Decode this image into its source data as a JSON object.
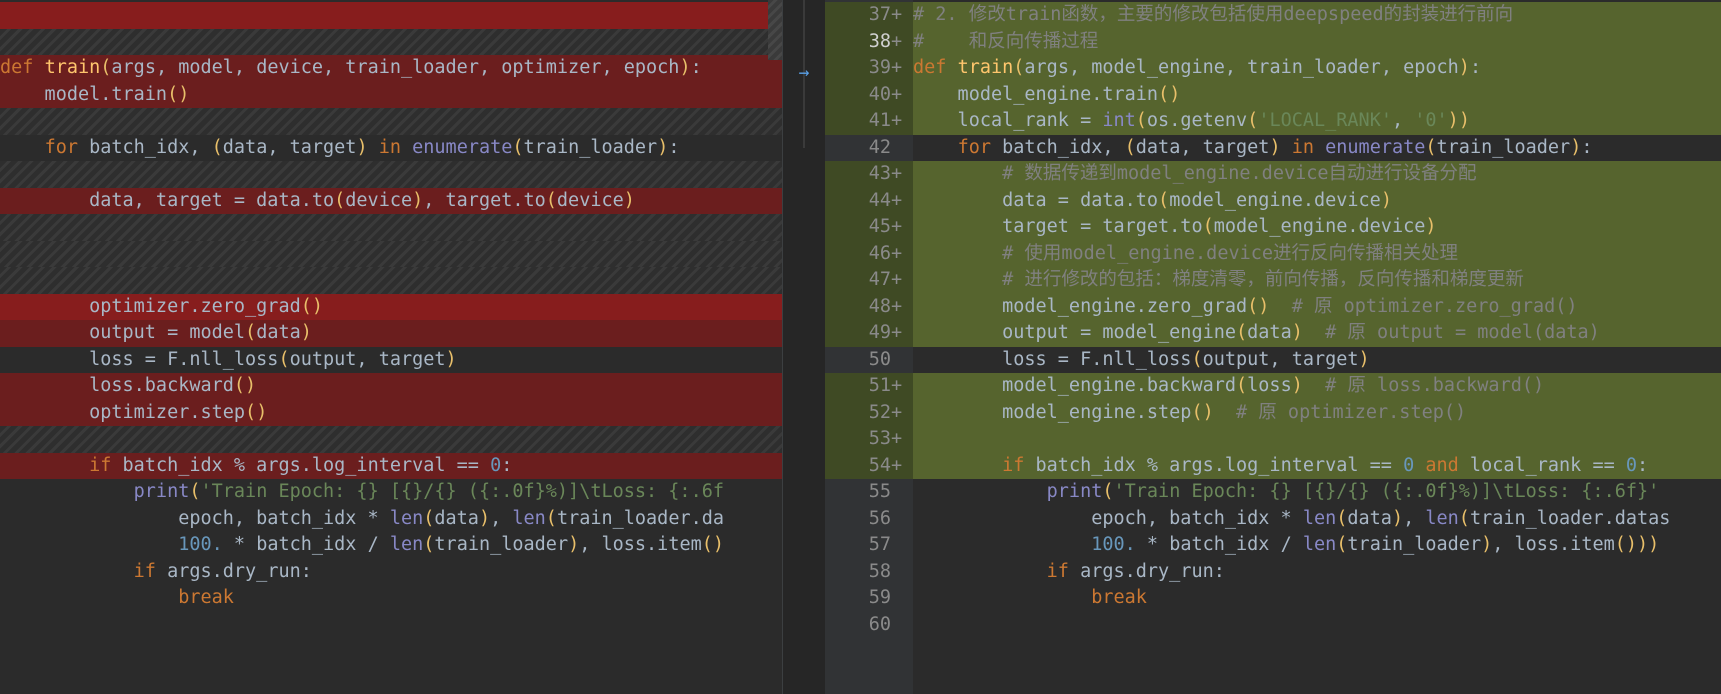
{
  "left": {
    "lines": [
      {
        "kind": "del-strong",
        "text": ""
      },
      {
        "kind": "hatch",
        "text": ""
      },
      {
        "kind": "del",
        "text": "def train(args, model, device, train_loader, optimizer, epoch):"
      },
      {
        "kind": "del",
        "text": "    model.train()"
      },
      {
        "kind": "hatch",
        "text": ""
      },
      {
        "kind": "plain",
        "text": "    for batch_idx, (data, target) in enumerate(train_loader):"
      },
      {
        "kind": "hatch",
        "text": ""
      },
      {
        "kind": "del",
        "text": "        data, target = data.to(device), target.to(device)"
      },
      {
        "kind": "hatch",
        "text": ""
      },
      {
        "kind": "hatch",
        "text": ""
      },
      {
        "kind": "hatch",
        "text": ""
      },
      {
        "kind": "del-strong",
        "text": "        optimizer.zero_grad()"
      },
      {
        "kind": "del",
        "text": "        output = model(data)"
      },
      {
        "kind": "plain",
        "text": "        loss = F.nll_loss(output, target)"
      },
      {
        "kind": "del",
        "text": "        loss.backward()"
      },
      {
        "kind": "del",
        "text": "        optimizer.step()"
      },
      {
        "kind": "hatch",
        "text": ""
      },
      {
        "kind": "del",
        "text": "        if batch_idx % args.log_interval == 0:"
      },
      {
        "kind": "plain",
        "text": "            print('Train Epoch: {} [{}/{} ({:.0f}%)]\\tLoss: {:.6f"
      },
      {
        "kind": "plain",
        "text": "                epoch, batch_idx * len(data), len(train_loader.da"
      },
      {
        "kind": "plain",
        "text": "                100. * batch_idx / len(train_loader), loss.item()"
      },
      {
        "kind": "plain",
        "text": "            if args.dry_run:"
      },
      {
        "kind": "plain",
        "text": "                break"
      },
      {
        "kind": "plain",
        "text": ""
      }
    ]
  },
  "right": {
    "lines": [
      {
        "num": "37",
        "mark": "+",
        "kind": "add",
        "text": "# 2. 修改train函数，主要的修改包括使用deepspeed的封装进行前向"
      },
      {
        "num": "38",
        "mark": "+",
        "kind": "add",
        "text": "#    和反向传播过程"
      },
      {
        "num": "39",
        "mark": "+",
        "kind": "add",
        "text": "def train(args, model_engine, train_loader, epoch):"
      },
      {
        "num": "40",
        "mark": "+",
        "kind": "add",
        "text": "    model_engine.train()"
      },
      {
        "num": "41",
        "mark": "+",
        "kind": "add",
        "text": "    local_rank = int(os.getenv('LOCAL_RANK', '0'))"
      },
      {
        "num": "42",
        "mark": "",
        "kind": "plain",
        "text": "    for batch_idx, (data, target) in enumerate(train_loader):"
      },
      {
        "num": "43",
        "mark": "+",
        "kind": "add",
        "text": "        # 数据传递到model_engine.device自动进行设备分配"
      },
      {
        "num": "44",
        "mark": "+",
        "kind": "add",
        "text": "        data = data.to(model_engine.device)"
      },
      {
        "num": "45",
        "mark": "+",
        "kind": "add",
        "text": "        target = target.to(model_engine.device)"
      },
      {
        "num": "46",
        "mark": "+",
        "kind": "add",
        "text": "        # 使用model_engine.device进行反向传播相关处理"
      },
      {
        "num": "47",
        "mark": "+",
        "kind": "add",
        "text": "        # 进行修改的包括：梯度清零，前向传播，反向传播和梯度更新"
      },
      {
        "num": "48",
        "mark": "+",
        "kind": "add",
        "text": "        model_engine.zero_grad()  # 原 optimizer.zero_grad()"
      },
      {
        "num": "49",
        "mark": "+",
        "kind": "add",
        "text": "        output = model_engine(data)  # 原 output = model(data)"
      },
      {
        "num": "50",
        "mark": "",
        "kind": "plain",
        "text": "        loss = F.nll_loss(output, target)"
      },
      {
        "num": "51",
        "mark": "+",
        "kind": "add",
        "text": "        model_engine.backward(loss)  # 原 loss.backward()"
      },
      {
        "num": "52",
        "mark": "+",
        "kind": "add",
        "text": "        model_engine.step()  # 原 optimizer.step()"
      },
      {
        "num": "53",
        "mark": "+",
        "kind": "add",
        "text": ""
      },
      {
        "num": "54",
        "mark": "+",
        "kind": "add",
        "text": "        if batch_idx % args.log_interval == 0 and local_rank == 0:"
      },
      {
        "num": "55",
        "mark": "",
        "kind": "plain",
        "text": "            print('Train Epoch: {} [{}/{} ({:.0f}%)]\\tLoss: {:.6f}'"
      },
      {
        "num": "56",
        "mark": "",
        "kind": "plain",
        "text": "                epoch, batch_idx * len(data), len(train_loader.datas"
      },
      {
        "num": "57",
        "mark": "",
        "kind": "plain",
        "text": "                100. * batch_idx / len(train_loader), loss.item()))"
      },
      {
        "num": "58",
        "mark": "",
        "kind": "plain",
        "text": "            if args.dry_run:"
      },
      {
        "num": "59",
        "mark": "",
        "kind": "plain",
        "text": "                break"
      },
      {
        "num": "60",
        "mark": "",
        "kind": "plain",
        "text": ""
      }
    ]
  },
  "icons": {
    "apply_change": "arrow-right-icon"
  },
  "colors": {
    "deleted": "#6b1e1e",
    "added": "#56642e",
    "keyword": "#cc7832",
    "function": "#ffc66d",
    "string": "#6a8759",
    "number": "#6897bb",
    "comment": "#808080"
  }
}
